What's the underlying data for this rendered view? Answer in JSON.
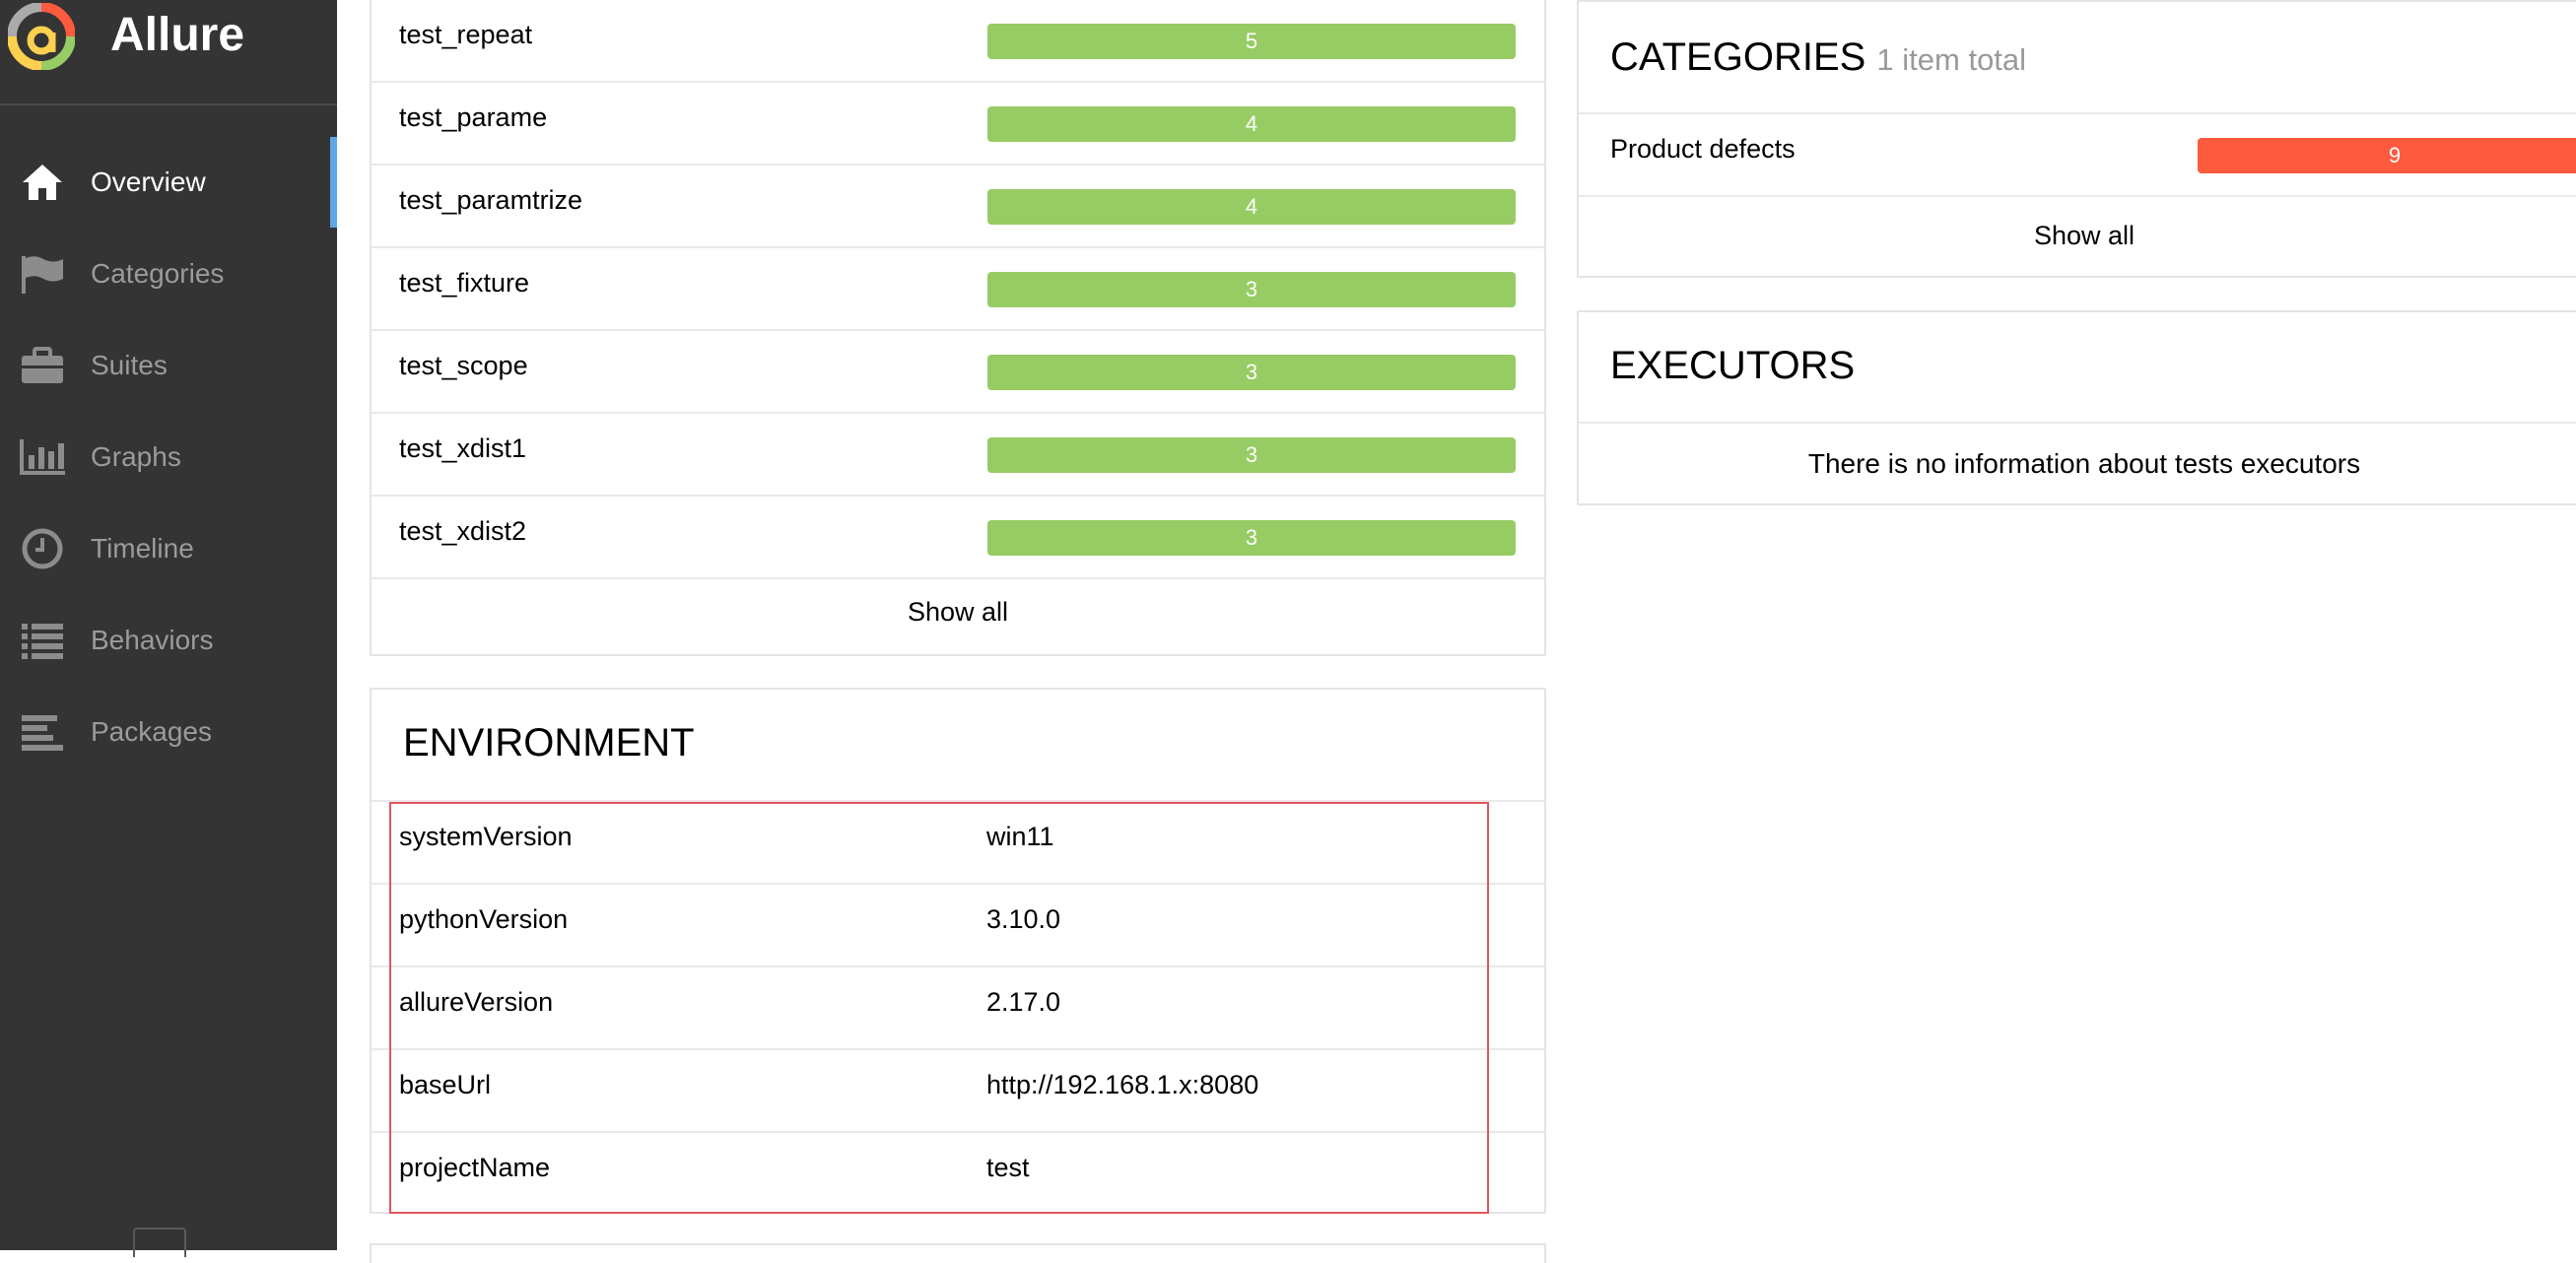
{
  "app": {
    "name": "Allure"
  },
  "nav": {
    "items": [
      {
        "label": "Overview",
        "icon": "home-icon",
        "active": true
      },
      {
        "label": "Categories",
        "icon": "flag-icon"
      },
      {
        "label": "Suites",
        "icon": "briefcase-icon"
      },
      {
        "label": "Graphs",
        "icon": "bar-chart-icon"
      },
      {
        "label": "Timeline",
        "icon": "clock-icon"
      },
      {
        "label": "Behaviors",
        "icon": "list-icon"
      },
      {
        "label": "Packages",
        "icon": "align-left-icon"
      }
    ]
  },
  "features": {
    "rows": [
      {
        "name": "test_repeat",
        "count": "5"
      },
      {
        "name": "test_parame",
        "count": "4"
      },
      {
        "name": "test_paramtrize",
        "count": "4"
      },
      {
        "name": "test_fixture",
        "count": "3"
      },
      {
        "name": "test_scope",
        "count": "3"
      },
      {
        "name": "test_xdist1",
        "count": "3"
      },
      {
        "name": "test_xdist2",
        "count": "3"
      }
    ],
    "show_all": "Show all"
  },
  "environment": {
    "title": "ENVIRONMENT",
    "rows": [
      {
        "key": "systemVersion",
        "value": "win11"
      },
      {
        "key": "pythonVersion",
        "value": "3.10.0"
      },
      {
        "key": "allureVersion",
        "value": "2.17.0"
      },
      {
        "key": "baseUrl",
        "value": "http://192.168.1.x:8080"
      },
      {
        "key": "projectName",
        "value": "test"
      }
    ]
  },
  "categories": {
    "title": "CATEGORIES",
    "subtitle": "1 item total",
    "rows": [
      {
        "name": "Product defects",
        "count": "9"
      }
    ],
    "show_all": "Show all"
  },
  "executors": {
    "title": "EXECUTORS",
    "empty": "There is no information about tests executors"
  },
  "colors": {
    "passed": "#97cc64",
    "failed": "#fd5a3e",
    "sidebar": "#343434",
    "active_marker": "#5da7e7"
  }
}
